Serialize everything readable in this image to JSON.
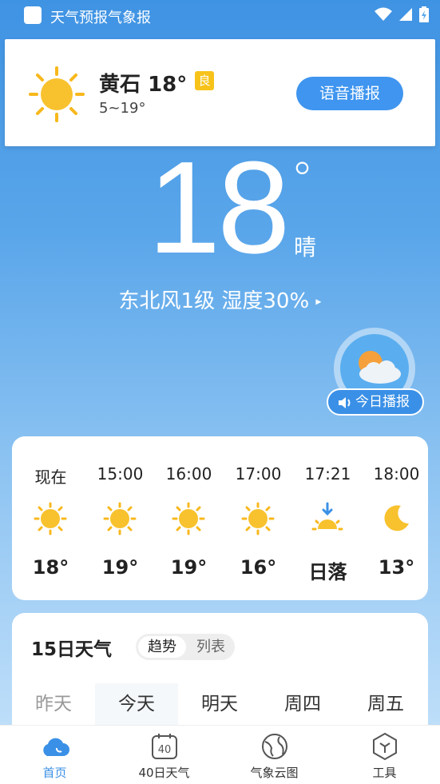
{
  "status_bar": {
    "app_title": "天气预报气象报"
  },
  "top_card": {
    "city": "黄石",
    "temp": "18°",
    "aqi_badge": "良",
    "range": "5~19°",
    "voice_button": "语音播报"
  },
  "current": {
    "temperature": "18",
    "degree_symbol": "°",
    "condition": "晴",
    "wind_humidity": "东北风1级  湿度30%",
    "arrow": "▸"
  },
  "today_broadcast": {
    "label": "今日播报"
  },
  "hourly": [
    {
      "time": "现在",
      "icon": "sun-icon",
      "value": "18°"
    },
    {
      "time": "15:00",
      "icon": "sun-icon",
      "value": "19°"
    },
    {
      "time": "16:00",
      "icon": "sun-icon",
      "value": "19°"
    },
    {
      "time": "17:00",
      "icon": "sun-icon",
      "value": "16°"
    },
    {
      "time": "17:21",
      "icon": "sunset-icon",
      "value": "日落"
    },
    {
      "time": "18:00",
      "icon": "moon-icon",
      "value": "13°"
    }
  ],
  "daily": {
    "title": "15日天气",
    "toggle": {
      "trend": "趋势",
      "list": "列表"
    },
    "days": [
      "昨天",
      "今天",
      "明天",
      "周四",
      "周五"
    ]
  },
  "nav": [
    {
      "label": "首页",
      "icon": "cloud-home-icon",
      "active": true
    },
    {
      "label": "40日天气",
      "icon": "calendar-40-icon",
      "active": false
    },
    {
      "label": "气象云图",
      "icon": "globe-icon",
      "active": false
    },
    {
      "label": "工具",
      "icon": "hexagon-tool-icon",
      "active": false
    }
  ],
  "colors": {
    "accent": "#3a90e6",
    "badge": "#f7c31a",
    "sun": "#f8b81c"
  }
}
